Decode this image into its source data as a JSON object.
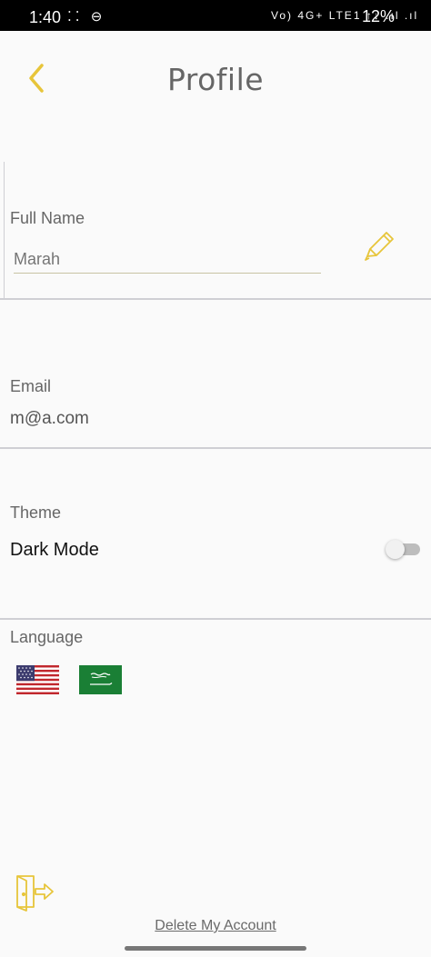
{
  "status_bar": {
    "time": "1:40",
    "left_icons": "⁚⁚ ⊖",
    "signal": "Vo) 4G+ LTE1 ↑↓ .ıl .ıl",
    "battery": "12%"
  },
  "header": {
    "title": "Profile",
    "back_icon": "chevron-left-icon",
    "accent_color": "#e7c53a"
  },
  "full_name": {
    "label": "Full Name",
    "value": "Marah",
    "edit_icon": "pencil-icon"
  },
  "email": {
    "label": "Email",
    "value": "m@a.com"
  },
  "theme": {
    "label": "Theme",
    "option_label": "Dark Mode",
    "dark_mode_on": false
  },
  "language": {
    "label": "Language",
    "options": [
      {
        "icon": "us-flag-icon",
        "code": "en"
      },
      {
        "icon": "saudi-flag-icon",
        "code": "ar"
      }
    ]
  },
  "footer": {
    "logout_icon": "logout-door-icon",
    "delete_account_label": "Delete My Account"
  }
}
